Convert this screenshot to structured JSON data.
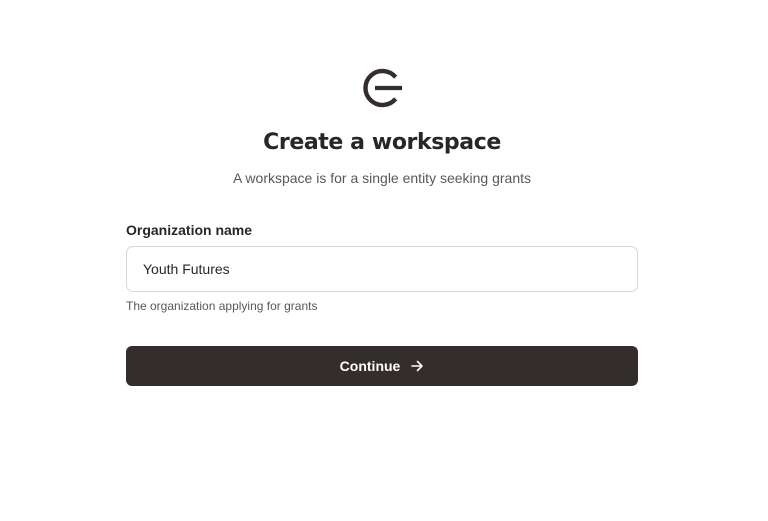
{
  "logo": {
    "icon": "circular-e-logo-icon",
    "color": "#332e2c"
  },
  "header": {
    "title": "Create a workspace",
    "subtitle": "A workspace is for a single entity seeking grants"
  },
  "form": {
    "org_label": "Organization name",
    "org_value": "Youth Futures",
    "org_hint": "The organization applying for grants"
  },
  "actions": {
    "continue_label": "Continue",
    "continue_icon": "arrow-right-icon",
    "button_color": "#332e2c"
  }
}
